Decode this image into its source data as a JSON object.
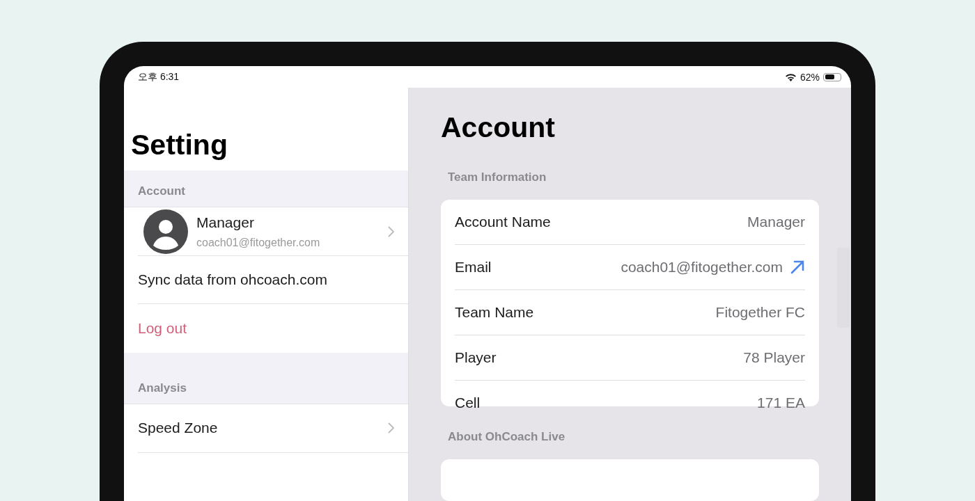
{
  "status_bar": {
    "time": "오후 6:31",
    "battery_text": "62%",
    "battery": {
      "level": 0.62
    }
  },
  "sidebar": {
    "title": "Setting",
    "sections": [
      {
        "header": "Account",
        "items": [
          {
            "kind": "profile",
            "name": "Manager",
            "email": "coach01@fitogether.com"
          },
          {
            "kind": "action",
            "label": "Sync data from ohcoach.com"
          },
          {
            "kind": "destructive",
            "label": "Log out"
          }
        ]
      },
      {
        "header": "Analysis",
        "items": [
          {
            "kind": "nav",
            "label": "Speed Zone"
          },
          {
            "kind": "blank"
          }
        ]
      }
    ]
  },
  "detail": {
    "title": "Account",
    "sections": [
      {
        "header": "Team Information",
        "rows": [
          {
            "kind": "text",
            "label": "Account Name",
            "value": "Manager"
          },
          {
            "kind": "link",
            "label": "Email",
            "value": "coach01@fitogether.com"
          },
          {
            "kind": "text",
            "label": "Team Name",
            "value": "Fitogether FC"
          },
          {
            "kind": "text",
            "label": "Player",
            "value": "78 Player"
          },
          {
            "kind": "text",
            "label": "Cell",
            "value": "171 EA"
          }
        ]
      },
      {
        "header": "About OhCoach Live"
      }
    ]
  }
}
